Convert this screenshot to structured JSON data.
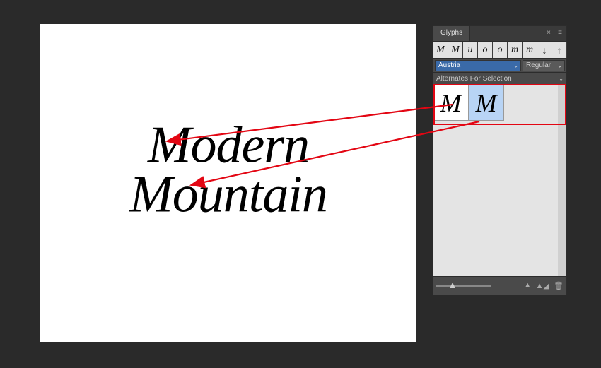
{
  "canvas": {
    "line1": "Modern",
    "line2": "Mountain"
  },
  "panel": {
    "tab_label": "Glyphs",
    "recent": [
      "M",
      "M",
      "u",
      "o",
      "o",
      "m",
      "m",
      "↓",
      "↑"
    ],
    "font_family": "Austria",
    "font_style": "Regular",
    "show_mode": "Alternates For Selection",
    "alternates": [
      "M",
      "M"
    ]
  },
  "annotation": {
    "color": "#e30613"
  }
}
